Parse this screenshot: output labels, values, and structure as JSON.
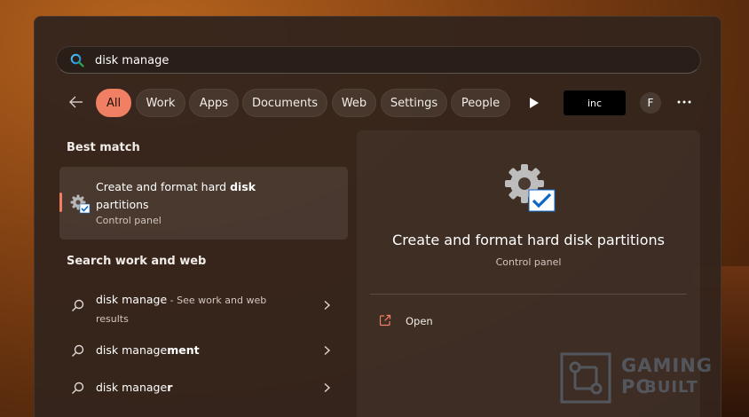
{
  "search": {
    "value": "disk manage"
  },
  "filters": {
    "back_icon": "arrow-left-icon",
    "chips": [
      "All",
      "Work",
      "Apps",
      "Documents",
      "Web",
      "Settings",
      "People"
    ],
    "active": "All",
    "play_icon": "play-icon",
    "inc_label": "inc",
    "avatar_letter": "F",
    "more_icon": "ellipsis-icon"
  },
  "best_match": {
    "heading": "Best match",
    "title_prefix": "Create and format hard ",
    "title_bold": "disk",
    "title_suffix": "partitions",
    "subtitle": "Control panel",
    "icon": "settings-gear-check-icon"
  },
  "search_web": {
    "heading": "Search work and web",
    "items": [
      {
        "query": "disk manage",
        "bold": "",
        "hint": " - See work and web",
        "hint2": "results"
      },
      {
        "query": "disk manage",
        "bold": "ment",
        "hint": "",
        "hint2": ""
      },
      {
        "query": "disk manage",
        "bold": "r",
        "hint": "",
        "hint2": ""
      }
    ]
  },
  "preview": {
    "title": "Create and format hard disk partitions",
    "subtitle": "Control panel",
    "open_label": "Open",
    "open_icon": "open-external-icon"
  },
  "watermark": {
    "line1": "GAMING PC",
    "line2": "BUILT"
  },
  "colors": {
    "accent": "#f07f63",
    "panel": "#34241c",
    "check_blue": "#0a67c9"
  }
}
